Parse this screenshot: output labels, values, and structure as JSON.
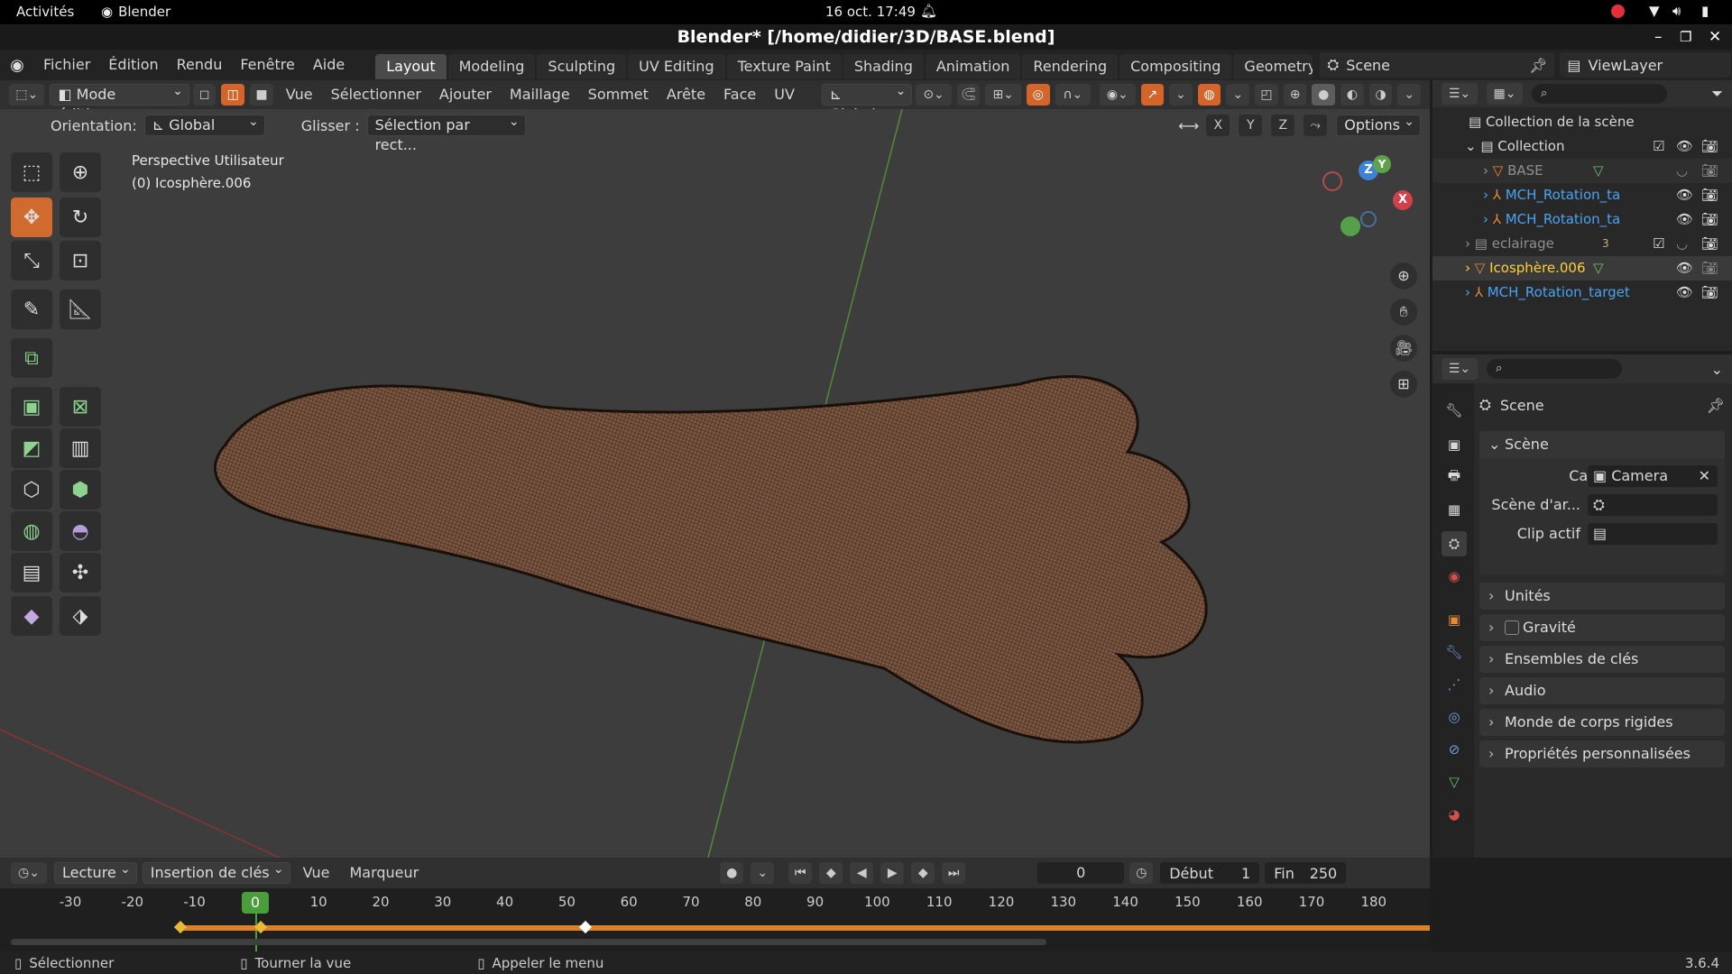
{
  "system_bar": {
    "activities": "Activités",
    "app": "Blender",
    "clock": "16 oct.  17:49"
  },
  "window": {
    "title": "Blender* [/home/didier/3D/BASE.blend]"
  },
  "menu": [
    "Fichier",
    "Édition",
    "Rendu",
    "Fenêtre",
    "Aide"
  ],
  "workspaces": [
    "Layout",
    "Modeling",
    "Sculpting",
    "UV Editing",
    "Texture Paint",
    "Shading",
    "Animation",
    "Rendering",
    "Compositing",
    "Geometry N"
  ],
  "scene_field": "Scene",
  "viewlayer_field": "ViewLayer",
  "viewport_header": {
    "mode": "Mode édition",
    "menus": [
      "Vue",
      "Sélectionner",
      "Ajouter",
      "Maillage",
      "Sommet",
      "Arête",
      "Face",
      "UV"
    ],
    "transform": "Global"
  },
  "tool_settings": {
    "orientation_label": "Orientation:",
    "orientation_value": "Global",
    "drag_label": "Glisser :",
    "drag_value": "Sélection par rect...",
    "axes": [
      "X",
      "Y",
      "Z"
    ],
    "options": "Options"
  },
  "viewport": {
    "view_name": "Perspective Utilisateur",
    "object_name": "(0) Icosphère.006"
  },
  "gizmo": {
    "x": "X",
    "y": "Y",
    "z": "Z"
  },
  "outliner": {
    "root": "Collection de la scène",
    "rows": [
      {
        "name": "Collection",
        "color": "#d8d8d8"
      },
      {
        "name": "BASE",
        "color": "#8f8f8f"
      },
      {
        "name": "MCH_Rotation_ta",
        "color": "#4aa3f0"
      },
      {
        "name": "MCH_Rotation_ta",
        "color": "#4aa3f0"
      },
      {
        "name": "eclairage",
        "color": "#8f8f8f"
      },
      {
        "name": "Icosphère.006",
        "color": "#ffcf3a"
      },
      {
        "name": "MCH_Rotation_target",
        "color": "#4aa3f0"
      }
    ],
    "light_count": "3"
  },
  "properties": {
    "header": "Scene",
    "section": "Scène",
    "camera_label": "Caméra",
    "camera_value": "Camera",
    "bg_label": "Scène d'ar...",
    "clip_label": "Clip actif",
    "collapsed": [
      "Unités",
      "Gravité",
      "Ensembles de clés",
      "Audio",
      "Monde de corps rigides",
      "Propriétés personnalisées"
    ]
  },
  "timeline": {
    "menus": [
      "Lecture",
      "Insertion de clés",
      "Vue",
      "Marqueur"
    ],
    "current_frame": "0",
    "start_label": "Début",
    "start": "1",
    "end_label": "Fin",
    "end": "250",
    "ruler": [
      "-30",
      "-20",
      "-10",
      "0",
      "10",
      "20",
      "30",
      "40",
      "50",
      "60",
      "70",
      "80",
      "90",
      "100",
      "110",
      "120",
      "130",
      "140",
      "150",
      "160",
      "170",
      "180"
    ]
  },
  "status": {
    "select": "Sélectionner",
    "rotate": "Tourner la vue",
    "menu": "Appeler le menu",
    "version": "3.6.4"
  },
  "colors": {
    "accent": "#d06a2f",
    "active_frame": "#4a9e3c",
    "mesh": "#6b4a36"
  }
}
